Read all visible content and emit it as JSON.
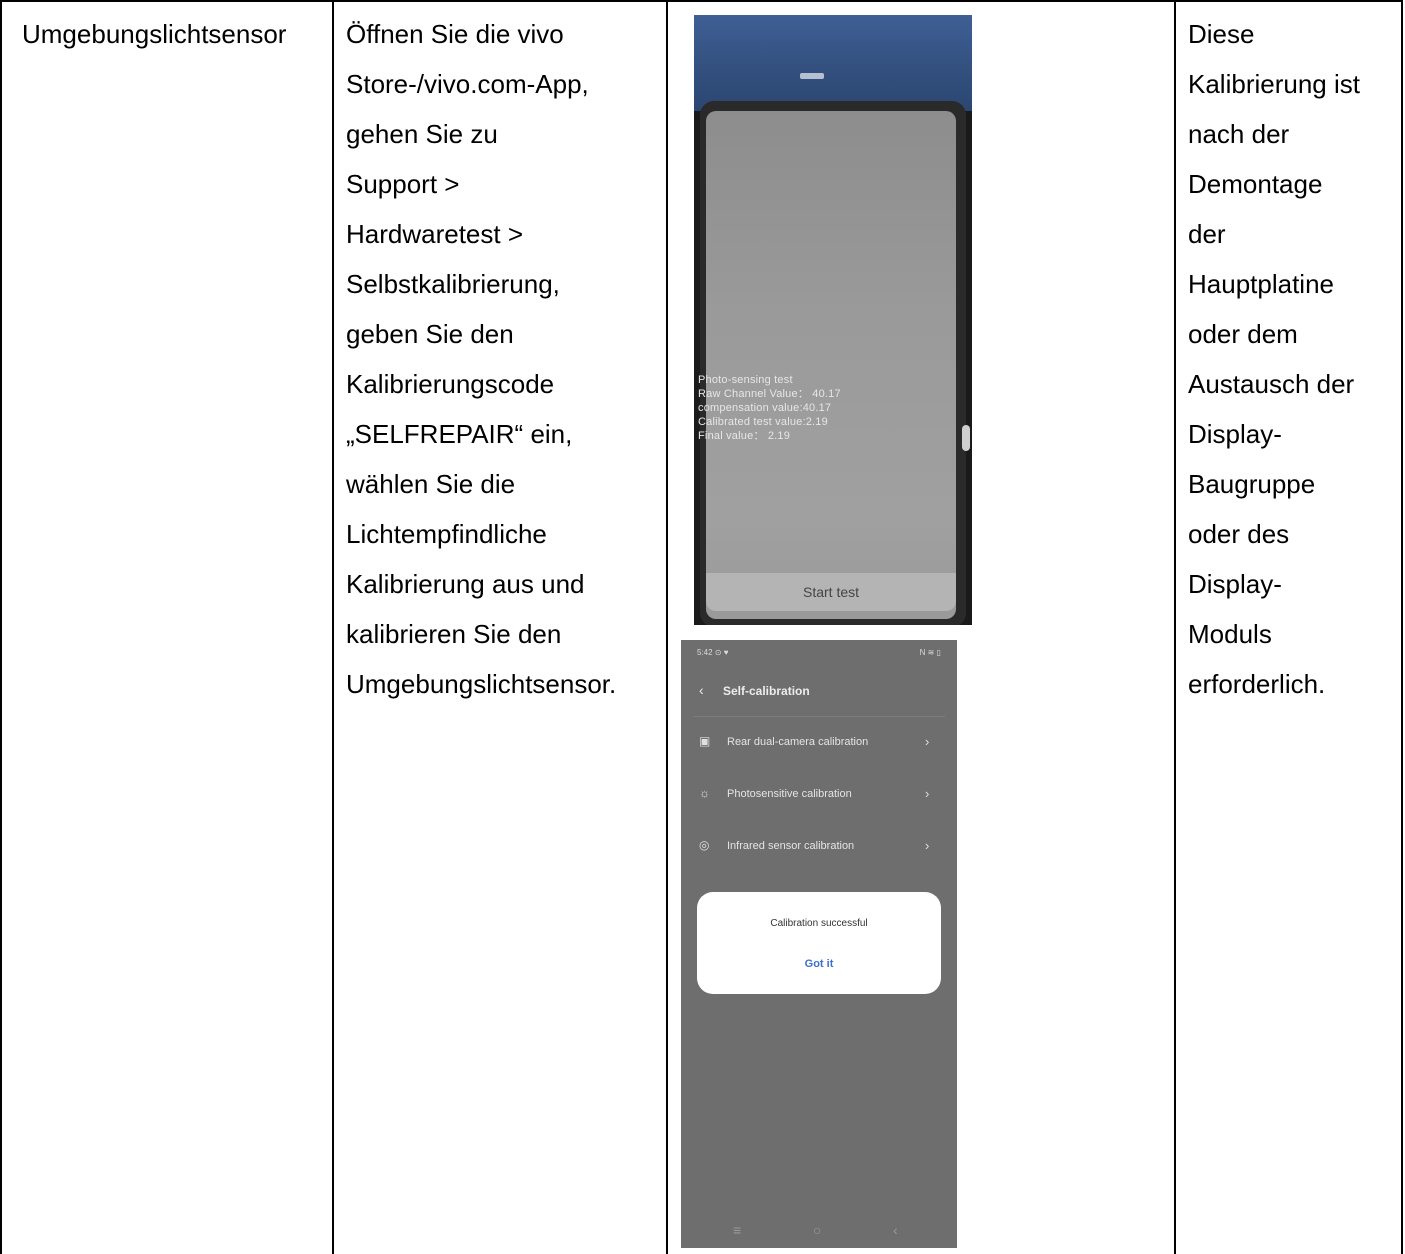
{
  "row": {
    "component": "Umgebungslichtsensor",
    "instructions": "Öffnen Sie die vivo\nStore-/vivo.com-App,\ngehen Sie zu\nSupport >\nHardwaretest >\nSelbstkalibrierung,\ngeben Sie den\nKalibrierungscode\n„SELFREPAIR“ ein,\nwählen Sie die\nLichtempfindliche\nKalibrierung aus und\nkalibrieren Sie den\nUmgebungslichtsensor.",
    "note": "Diese\nKalibrierung ist\nnach der\nDemontage\nder\nHauptplatine\noder dem\nAustausch der\nDisplay-\nBaugruppe\noder des\nDisplay-\nModuls\nerforderlich."
  },
  "photo": {
    "readout": "Photo-sensing test\nRaw Channel Value： 40.17\ncompensation value:40.17\nCalibrated test value:2.19\nFinal value： 2.19",
    "start_button": "Start test"
  },
  "screenshot": {
    "status_time": "5:42 ⊙ ♥",
    "status_right": "N ≋ ▯",
    "title": "Self-calibration",
    "items": [
      {
        "label": "Rear dual-camera calibration",
        "icon": "camera-icon"
      },
      {
        "label": "Photosensitive calibration",
        "icon": "sun-icon"
      },
      {
        "label": "Infrared sensor calibration",
        "icon": "infrared-icon"
      }
    ],
    "dialog": {
      "message": "Calibration successful",
      "button": "Got it"
    },
    "nav": {
      "menu": "≡",
      "home": "○",
      "back": "‹"
    }
  }
}
